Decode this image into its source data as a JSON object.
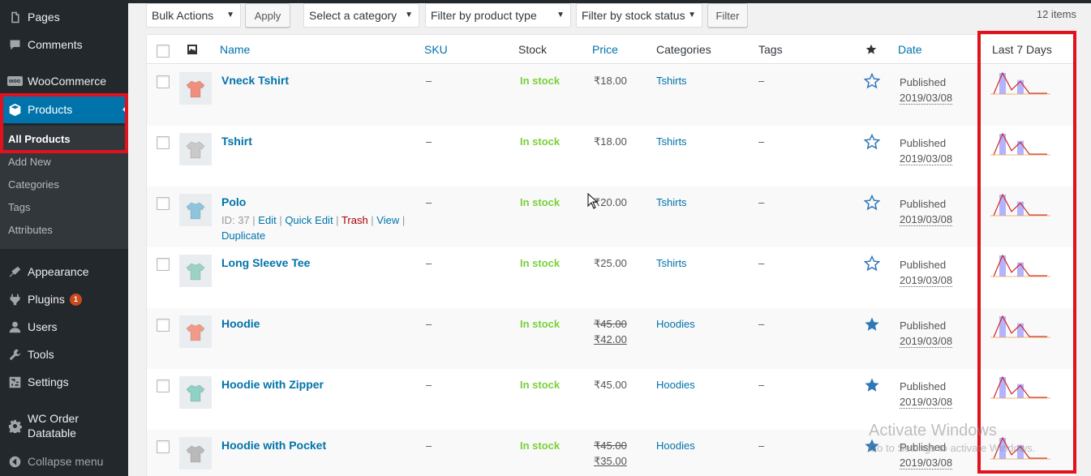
{
  "sidebar": {
    "items": [
      {
        "label": "Pages",
        "icon": "pages-icon"
      },
      {
        "label": "Comments",
        "icon": "comments-icon"
      },
      {
        "label": "WooCommerce",
        "icon": "woocommerce-icon"
      },
      {
        "label": "Products",
        "icon": "products-icon"
      },
      {
        "label": "Appearance",
        "icon": "appearance-icon"
      },
      {
        "label": "Plugins",
        "icon": "plugins-icon",
        "badge": "1"
      },
      {
        "label": "Users",
        "icon": "users-icon"
      },
      {
        "label": "Tools",
        "icon": "tools-icon"
      },
      {
        "label": "Settings",
        "icon": "settings-icon"
      },
      {
        "label": "WC Order Datatable",
        "icon": "gear-icon"
      },
      {
        "label": "Collapse menu",
        "icon": "collapse-icon"
      }
    ],
    "submenu": [
      "All Products",
      "Add New",
      "Categories",
      "Tags",
      "Attributes"
    ],
    "woo_logo_text": "woo"
  },
  "filters": {
    "bulk_actions": "Bulk Actions",
    "apply": "Apply",
    "category": "Select a category",
    "product_type": "Filter by product type",
    "stock_status": "Filter by stock status",
    "filter": "Filter",
    "items_count": "12 items"
  },
  "table": {
    "headers": {
      "name": "Name",
      "sku": "SKU",
      "stock": "Stock",
      "price": "Price",
      "categories": "Categories",
      "tags": "Tags",
      "date": "Date",
      "last7": "Last 7 Days"
    },
    "rows": [
      {
        "name": "Vneck Tshirt",
        "sku": "–",
        "stock": "In stock",
        "price": "₹18.00",
        "old_price": "",
        "category": "Tshirts",
        "tags": "–",
        "featured": false,
        "status": "Published",
        "date": "2019/03/08",
        "color": "#f08f7c"
      },
      {
        "name": "Tshirt",
        "sku": "–",
        "stock": "In stock",
        "price": "₹18.00",
        "old_price": "",
        "category": "Tshirts",
        "tags": "–",
        "featured": false,
        "status": "Published",
        "date": "2019/03/08",
        "color": "#c9c9c9"
      },
      {
        "name": "Polo",
        "sku": "–",
        "stock": "In stock",
        "price": "₹20.00",
        "old_price": "",
        "category": "Tshirts",
        "tags": "–",
        "featured": false,
        "status": "Published",
        "date": "2019/03/08",
        "color": "#8ec5dc",
        "actions": {
          "id": "ID: 37",
          "edit": "Edit",
          "quick_edit": "Quick Edit",
          "trash": "Trash",
          "view": "View",
          "duplicate": "Duplicate"
        }
      },
      {
        "name": "Long Sleeve Tee",
        "sku": "–",
        "stock": "In stock",
        "price": "₹25.00",
        "old_price": "",
        "category": "Tshirts",
        "tags": "–",
        "featured": false,
        "status": "Published",
        "date": "2019/03/08",
        "color": "#9bd3c3"
      },
      {
        "name": "Hoodie",
        "sku": "–",
        "stock": "In stock",
        "price": "₹42.00",
        "old_price": "₹45.00",
        "category": "Hoodies",
        "tags": "–",
        "featured": true,
        "status": "Published",
        "date": "2019/03/08",
        "color": "#f29a88"
      },
      {
        "name": "Hoodie with Zipper",
        "sku": "–",
        "stock": "In stock",
        "price": "₹45.00",
        "old_price": "",
        "category": "Hoodies",
        "tags": "–",
        "featured": true,
        "status": "Published",
        "date": "2019/03/08",
        "color": "#8fd0c7"
      },
      {
        "name": "Hoodie with Pocket",
        "sku": "–",
        "stock": "In stock",
        "price": "₹35.00",
        "old_price": "₹45.00",
        "category": "Hoodies",
        "tags": "–",
        "featured": true,
        "status": "Published",
        "date": "2019/03/08",
        "color": "#b9b9b9"
      }
    ],
    "sparkline": {
      "bar_values": [
        0,
        3,
        0,
        2,
        0,
        0,
        0
      ],
      "line_values": [
        0,
        3,
        0.6,
        1.8,
        0.1,
        0.1,
        0.1
      ],
      "bar_color": "#b3b3ff",
      "line_color": "#d0271d"
    }
  },
  "watermark": {
    "title": "Activate Windows",
    "subtitle": "Go to Settings to activate Windows."
  },
  "colors": {
    "accent": "#0073aa",
    "highlight": "#e0121e",
    "in_stock": "#7ad03a"
  }
}
